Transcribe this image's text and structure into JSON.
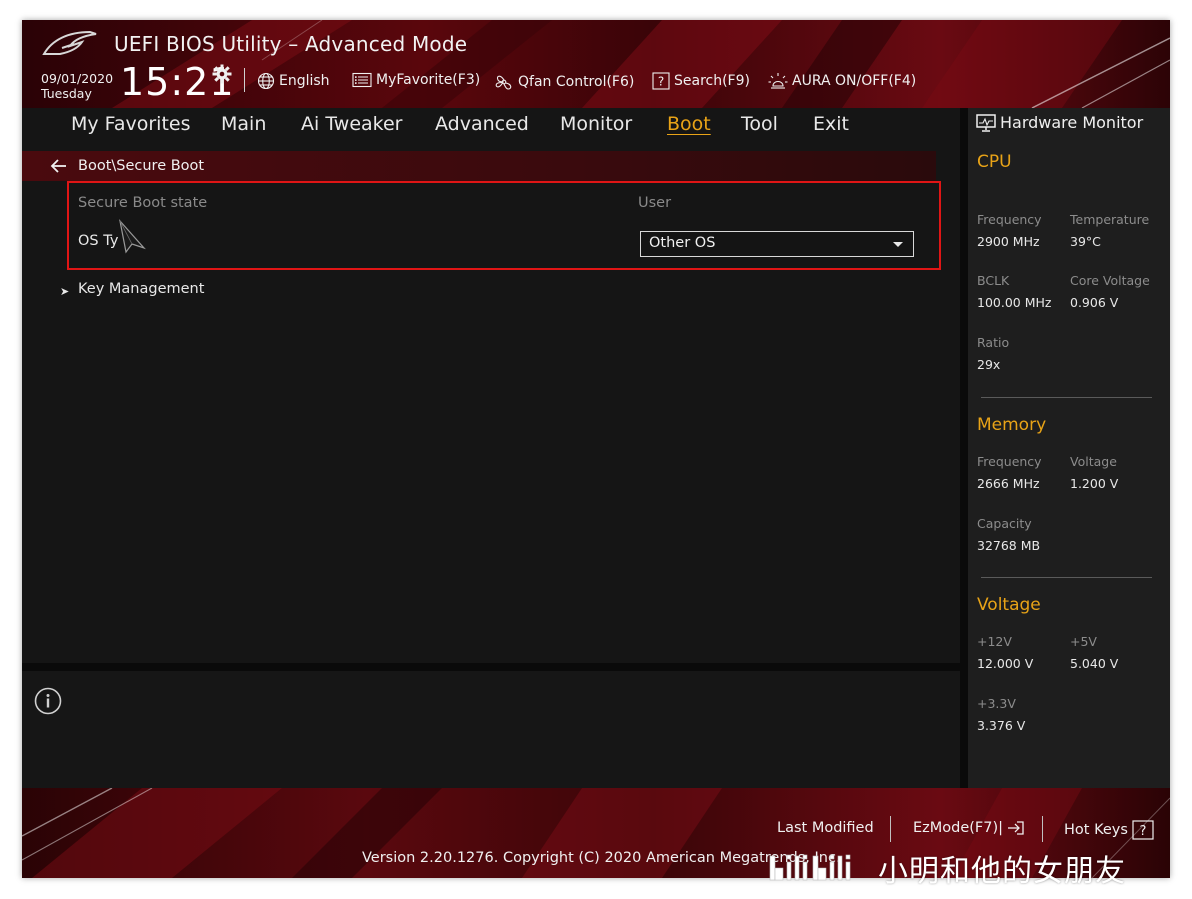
{
  "header": {
    "title": "UEFI BIOS Utility – Advanced Mode",
    "date": "09/01/2020",
    "day": "Tuesday",
    "time": "15:21",
    "items": [
      {
        "label": "English",
        "icon": "globe-icon"
      },
      {
        "label": "MyFavorite(F3)",
        "icon": "favorite-list-icon"
      },
      {
        "label": "Qfan Control(F6)",
        "icon": "fan-icon"
      },
      {
        "label": "Search(F9)",
        "icon": "question-box-icon"
      },
      {
        "label": "AURA ON/OFF(F4)",
        "icon": "aura-light-icon"
      }
    ]
  },
  "nav": {
    "tabs": [
      "My Favorites",
      "Main",
      "Ai Tweaker",
      "Advanced",
      "Monitor",
      "Boot",
      "Tool",
      "Exit"
    ],
    "active": "Boot"
  },
  "content": {
    "breadcrumb": "Boot\\Secure Boot",
    "rows": [
      {
        "label": "Secure Boot state",
        "value": "User"
      },
      {
        "label": "OS Ty",
        "select_value": "Other OS"
      }
    ],
    "submenu": "Key Management"
  },
  "hardware_monitor": {
    "title": "Hardware Monitor",
    "cpu": {
      "heading": "CPU",
      "frequency_label": "Frequency",
      "frequency": "2900 MHz",
      "temperature_label": "Temperature",
      "temperature": "39°C",
      "bclk_label": "BCLK",
      "bclk": "100.00 MHz",
      "core_voltage_label": "Core Voltage",
      "core_voltage": "0.906 V",
      "ratio_label": "Ratio",
      "ratio": "29x"
    },
    "memory": {
      "heading": "Memory",
      "frequency_label": "Frequency",
      "frequency": "2666 MHz",
      "voltage_label": "Voltage",
      "voltage": "1.200 V",
      "capacity_label": "Capacity",
      "capacity": "32768 MB"
    },
    "voltage": {
      "heading": "Voltage",
      "v12_label": "+12V",
      "v12": "12.000 V",
      "v5_label": "+5V",
      "v5": "5.040 V",
      "v33_label": "+3.3V",
      "v33": "3.376 V"
    }
  },
  "footer": {
    "last_modified": "Last Modified",
    "ezmode": "EzMode(F7)|",
    "hot_keys": "Hot Keys",
    "version": "Version 2.20.1276. Copyright (C) 2020 American Megatrends, Inc."
  },
  "watermark": {
    "text": "小明和他的女朋友"
  },
  "colors": {
    "accent": "#e8a317",
    "highlight_border": "#e01515",
    "header_red": "#5a060c",
    "panel_bg": "#151515"
  }
}
